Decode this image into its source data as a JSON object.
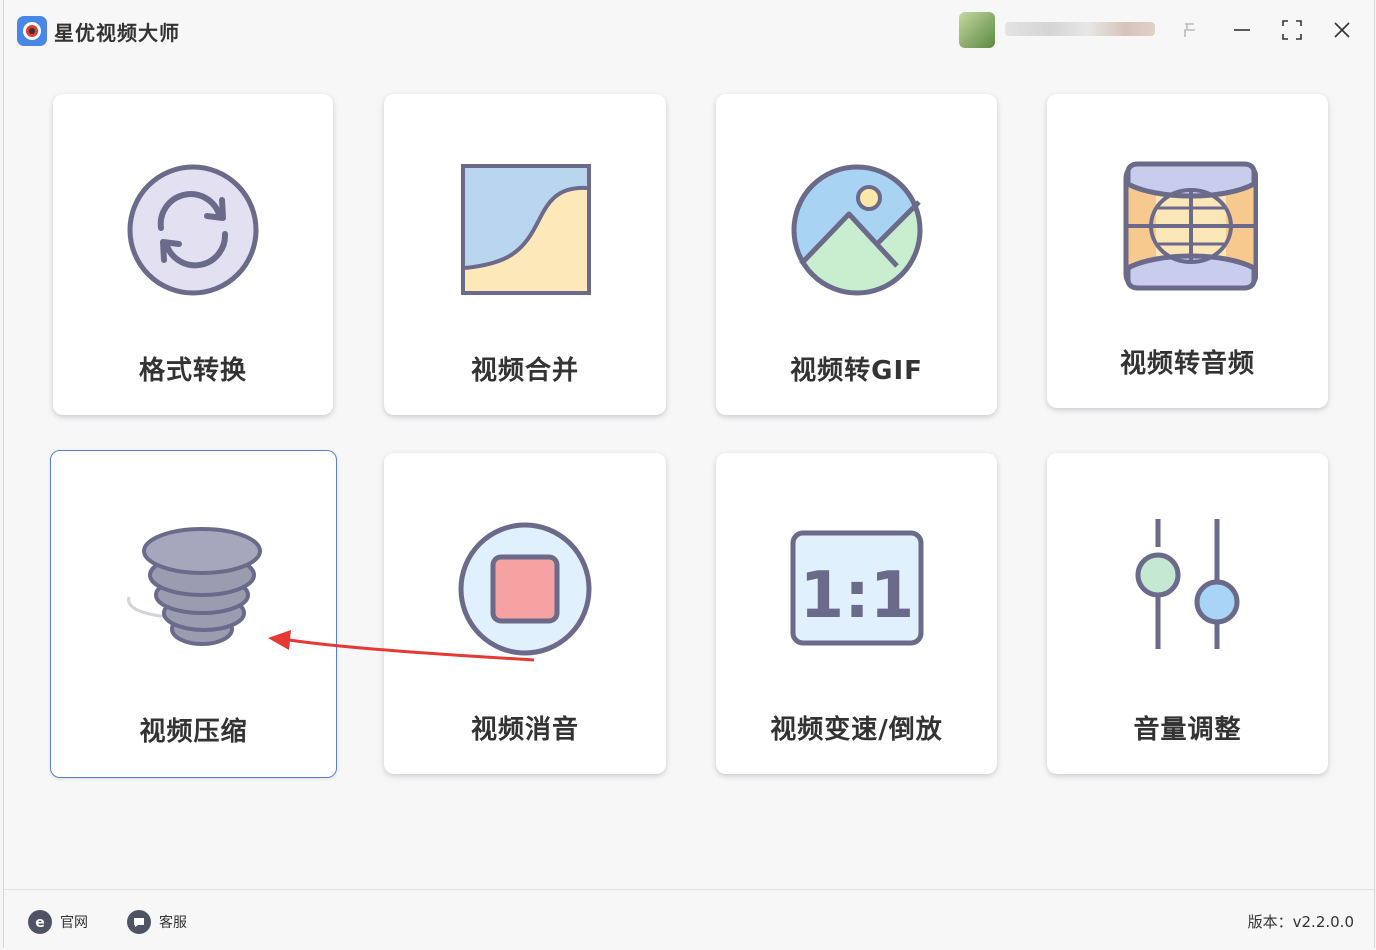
{
  "app": {
    "title": "星优视频大师"
  },
  "window_controls": [
    "pin",
    "minimize",
    "maximize",
    "close"
  ],
  "cards": [
    {
      "label": "格式转换",
      "icon": "convert-icon"
    },
    {
      "label": "视频合并",
      "icon": "merge-icon"
    },
    {
      "label": "视频转GIF",
      "icon": "gif-icon"
    },
    {
      "label": "视频转音频",
      "icon": "audio-icon"
    },
    {
      "label": "视频压缩",
      "icon": "compress-icon",
      "selected": true
    },
    {
      "label": "视频消音",
      "icon": "mute-icon"
    },
    {
      "label": "视频变速/倒放",
      "icon": "speed-icon"
    },
    {
      "label": "音量调整",
      "icon": "volume-icon"
    }
  ],
  "speed_icon_text": "1:1",
  "footer": {
    "website": "官网",
    "support": "客服",
    "version": "版本：v2.2.0.0"
  },
  "colors": {
    "selected_border": "#5b7fd6",
    "arrow": "#e53935"
  }
}
